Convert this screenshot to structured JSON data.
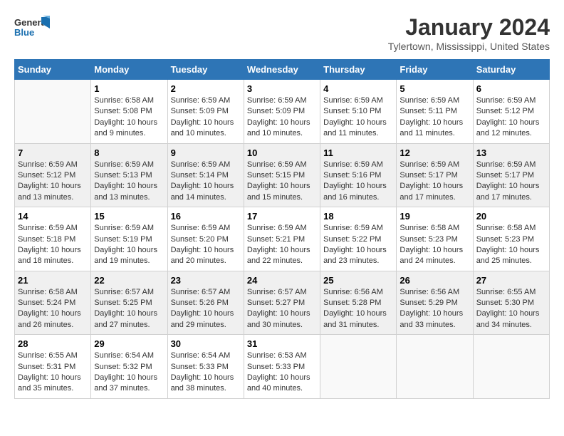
{
  "logo": {
    "general": "General",
    "blue": "Blue"
  },
  "header": {
    "month": "January 2024",
    "location": "Tylertown, Mississippi, United States"
  },
  "days_of_week": [
    "Sunday",
    "Monday",
    "Tuesday",
    "Wednesday",
    "Thursday",
    "Friday",
    "Saturday"
  ],
  "weeks": [
    [
      {
        "day": "",
        "info": ""
      },
      {
        "day": "1",
        "info": "Sunrise: 6:58 AM\nSunset: 5:08 PM\nDaylight: 10 hours\nand 9 minutes."
      },
      {
        "day": "2",
        "info": "Sunrise: 6:59 AM\nSunset: 5:09 PM\nDaylight: 10 hours\nand 10 minutes."
      },
      {
        "day": "3",
        "info": "Sunrise: 6:59 AM\nSunset: 5:09 PM\nDaylight: 10 hours\nand 10 minutes."
      },
      {
        "day": "4",
        "info": "Sunrise: 6:59 AM\nSunset: 5:10 PM\nDaylight: 10 hours\nand 11 minutes."
      },
      {
        "day": "5",
        "info": "Sunrise: 6:59 AM\nSunset: 5:11 PM\nDaylight: 10 hours\nand 11 minutes."
      },
      {
        "day": "6",
        "info": "Sunrise: 6:59 AM\nSunset: 5:12 PM\nDaylight: 10 hours\nand 12 minutes."
      }
    ],
    [
      {
        "day": "7",
        "info": "Sunrise: 6:59 AM\nSunset: 5:12 PM\nDaylight: 10 hours\nand 13 minutes."
      },
      {
        "day": "8",
        "info": "Sunrise: 6:59 AM\nSunset: 5:13 PM\nDaylight: 10 hours\nand 13 minutes."
      },
      {
        "day": "9",
        "info": "Sunrise: 6:59 AM\nSunset: 5:14 PM\nDaylight: 10 hours\nand 14 minutes."
      },
      {
        "day": "10",
        "info": "Sunrise: 6:59 AM\nSunset: 5:15 PM\nDaylight: 10 hours\nand 15 minutes."
      },
      {
        "day": "11",
        "info": "Sunrise: 6:59 AM\nSunset: 5:16 PM\nDaylight: 10 hours\nand 16 minutes."
      },
      {
        "day": "12",
        "info": "Sunrise: 6:59 AM\nSunset: 5:17 PM\nDaylight: 10 hours\nand 17 minutes."
      },
      {
        "day": "13",
        "info": "Sunrise: 6:59 AM\nSunset: 5:17 PM\nDaylight: 10 hours\nand 17 minutes."
      }
    ],
    [
      {
        "day": "14",
        "info": "Sunrise: 6:59 AM\nSunset: 5:18 PM\nDaylight: 10 hours\nand 18 minutes."
      },
      {
        "day": "15",
        "info": "Sunrise: 6:59 AM\nSunset: 5:19 PM\nDaylight: 10 hours\nand 19 minutes."
      },
      {
        "day": "16",
        "info": "Sunrise: 6:59 AM\nSunset: 5:20 PM\nDaylight: 10 hours\nand 20 minutes."
      },
      {
        "day": "17",
        "info": "Sunrise: 6:59 AM\nSunset: 5:21 PM\nDaylight: 10 hours\nand 22 minutes."
      },
      {
        "day": "18",
        "info": "Sunrise: 6:59 AM\nSunset: 5:22 PM\nDaylight: 10 hours\nand 23 minutes."
      },
      {
        "day": "19",
        "info": "Sunrise: 6:58 AM\nSunset: 5:23 PM\nDaylight: 10 hours\nand 24 minutes."
      },
      {
        "day": "20",
        "info": "Sunrise: 6:58 AM\nSunset: 5:23 PM\nDaylight: 10 hours\nand 25 minutes."
      }
    ],
    [
      {
        "day": "21",
        "info": "Sunrise: 6:58 AM\nSunset: 5:24 PM\nDaylight: 10 hours\nand 26 minutes."
      },
      {
        "day": "22",
        "info": "Sunrise: 6:57 AM\nSunset: 5:25 PM\nDaylight: 10 hours\nand 27 minutes."
      },
      {
        "day": "23",
        "info": "Sunrise: 6:57 AM\nSunset: 5:26 PM\nDaylight: 10 hours\nand 29 minutes."
      },
      {
        "day": "24",
        "info": "Sunrise: 6:57 AM\nSunset: 5:27 PM\nDaylight: 10 hours\nand 30 minutes."
      },
      {
        "day": "25",
        "info": "Sunrise: 6:56 AM\nSunset: 5:28 PM\nDaylight: 10 hours\nand 31 minutes."
      },
      {
        "day": "26",
        "info": "Sunrise: 6:56 AM\nSunset: 5:29 PM\nDaylight: 10 hours\nand 33 minutes."
      },
      {
        "day": "27",
        "info": "Sunrise: 6:55 AM\nSunset: 5:30 PM\nDaylight: 10 hours\nand 34 minutes."
      }
    ],
    [
      {
        "day": "28",
        "info": "Sunrise: 6:55 AM\nSunset: 5:31 PM\nDaylight: 10 hours\nand 35 minutes."
      },
      {
        "day": "29",
        "info": "Sunrise: 6:54 AM\nSunset: 5:32 PM\nDaylight: 10 hours\nand 37 minutes."
      },
      {
        "day": "30",
        "info": "Sunrise: 6:54 AM\nSunset: 5:33 PM\nDaylight: 10 hours\nand 38 minutes."
      },
      {
        "day": "31",
        "info": "Sunrise: 6:53 AM\nSunset: 5:33 PM\nDaylight: 10 hours\nand 40 minutes."
      },
      {
        "day": "",
        "info": ""
      },
      {
        "day": "",
        "info": ""
      },
      {
        "day": "",
        "info": ""
      }
    ]
  ]
}
